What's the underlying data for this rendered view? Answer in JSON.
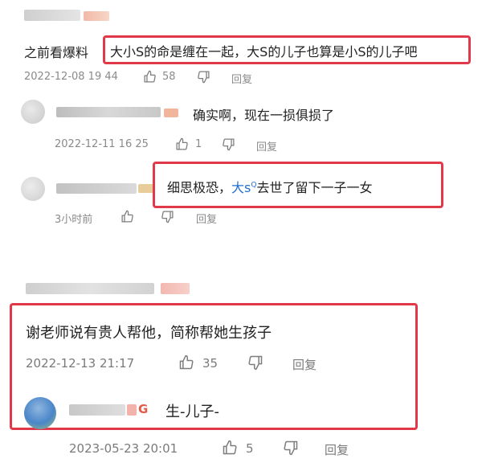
{
  "colors": {
    "highlight_border": "#e03a4a",
    "mention_blue": "#1f6fd1",
    "meta_gray": "#8a8a8a"
  },
  "comments": [
    {
      "text_prefix": "之前看爆料",
      "text_highlight": "大小S的命是缠在一起，大S的儿子也算是小S的儿子吧",
      "date": "2022-12-08 19 44",
      "likes": "58",
      "reply_label": "回复"
    },
    {
      "text": "确实啊，现在一损俱损了",
      "date": "2022-12-11 16 25",
      "likes": "1",
      "reply_label": "回复"
    },
    {
      "text_before": "细思极恐，",
      "mention": "大s",
      "mention_sup": "Q",
      "text_after": "去世了留下一子一女",
      "date": "3小时前",
      "reply_label": "回复"
    },
    {
      "text": "谢老师说有贵人帮他，简称帮她生孩子",
      "date": "2022-12-13 21:17",
      "likes": "35",
      "reply_label": "回复"
    },
    {
      "text": "生-儿子-",
      "date": "2023-05-23 20:01",
      "likes": "5",
      "reply_label": "回复"
    }
  ]
}
